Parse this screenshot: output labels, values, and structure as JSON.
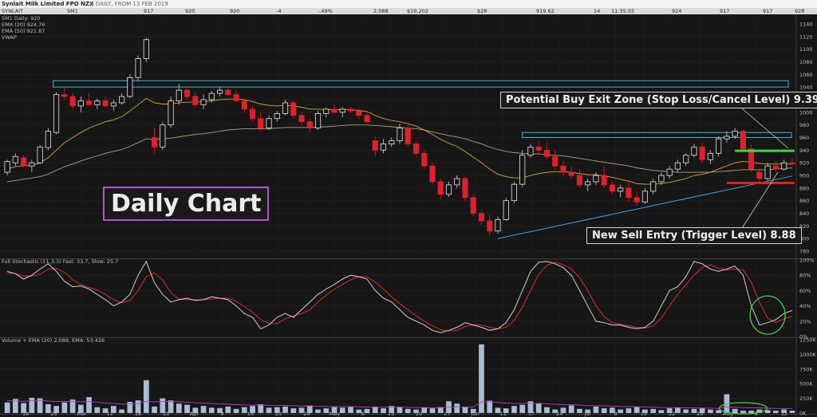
{
  "header": {
    "title": "Synlait Milk Limited FPO NZX",
    "subtitle": "DAILY, FROM 13 FEB 2019",
    "cells": [
      {
        "text": "SYNLAIT",
        "x": 2
      },
      {
        "text": "SM1",
        "x": 84
      },
      {
        "text": "917",
        "x": 180
      },
      {
        "text": "920",
        "x": 232
      },
      {
        "text": "920",
        "x": 288
      },
      {
        "text": "-4",
        "x": 346
      },
      {
        "text": "-.49%",
        "x": 398
      },
      {
        "text": "2,088",
        "x": 468
      },
      {
        "text": "$19,202",
        "x": 510
      },
      {
        "text": "$28",
        "x": 598
      },
      {
        "text": "919.62",
        "x": 672
      },
      {
        "text": "14",
        "x": 744
      },
      {
        "text": "11:35:55",
        "x": 766
      },
      {
        "text": "924",
        "x": 842
      },
      {
        "text": "917",
        "x": 902
      },
      {
        "text": "917",
        "x": 956
      },
      {
        "text": "928",
        "x": 996
      }
    ]
  },
  "legend": {
    "price": [
      "SM1 Daily: 920",
      "EMA (20) 924.76",
      "EMA (50) 921.87",
      "VWAP"
    ],
    "stoch": "Full Stochastic (11,3,3) Fast: 33.7, Slow: 25.7",
    "volume": "Volume + EMA (20) 2,088, EMA: 53,426"
  },
  "callouts": {
    "buy": "Potential Buy Exit Zone (Stop Loss/Cancel Level) 9.39",
    "sell": "New Sell Entry (Trigger Level) 8.88",
    "daily": "Daily Chart"
  },
  "colors": {
    "up": "#ffffff",
    "down": "#e0202a",
    "ema20": "#d8a637",
    "ema50": "#b2a070",
    "resistance": "#38b8e6",
    "trend": "#3f9fe6",
    "stochFast": "#d0d0d0",
    "stochSlow": "#e02a2a",
    "volEma": "#c03cc0",
    "volBar": "#a8bcd6",
    "buyZone": "#3fd24a",
    "sellLine": "#e02020",
    "highlight": "#3fd24a"
  },
  "chart_data": [
    {
      "type": "candlestick",
      "title": "",
      "ylim": [
        770,
        1150
      ],
      "yticks": [
        780,
        800,
        820,
        840,
        860,
        880,
        900,
        920,
        940,
        960,
        980,
        1000,
        1020,
        1040,
        1060,
        1080,
        1100,
        1120,
        1140
      ],
      "xticks": [
        "18",
        "25",
        "Mar",
        "11",
        "18",
        "25",
        "Apr",
        "8",
        "15",
        "23",
        "29",
        "May",
        "6",
        "13",
        "20",
        "27",
        "Jun",
        "11",
        "17",
        "24",
        "Jul",
        "8",
        "15",
        "22",
        "29",
        "Aug",
        "6",
        "12"
      ],
      "ohlc": [
        [
          905,
          925,
          900,
          922
        ],
        [
          920,
          935,
          915,
          930
        ],
        [
          928,
          932,
          912,
          915
        ],
        [
          915,
          925,
          905,
          920
        ],
        [
          920,
          948,
          918,
          945
        ],
        [
          944,
          975,
          940,
          970
        ],
        [
          968,
          1032,
          965,
          1028
        ],
        [
          1028,
          1040,
          1020,
          1025
        ],
        [
          1025,
          1030,
          1005,
          1010
        ],
        [
          1010,
          1025,
          1000,
          1018
        ],
        [
          1018,
          1030,
          1010,
          1012
        ],
        [
          1012,
          1022,
          1005,
          1018
        ],
        [
          1018,
          1025,
          1008,
          1010
        ],
        [
          1010,
          1020,
          1002,
          1015
        ],
        [
          1015,
          1030,
          1012,
          1025
        ],
        [
          1025,
          1060,
          1022,
          1055
        ],
        [
          1055,
          1090,
          1050,
          1085
        ],
        [
          1085,
          1118,
          1080,
          1115
        ],
        [
          960,
          975,
          935,
          945
        ],
        [
          945,
          985,
          940,
          980
        ],
        [
          980,
          1025,
          975,
          1018
        ],
        [
          1018,
          1045,
          1012,
          1035
        ],
        [
          1035,
          1040,
          1020,
          1025
        ],
        [
          1025,
          1032,
          1008,
          1012
        ],
        [
          1012,
          1028,
          1005,
          1020
        ],
        [
          1020,
          1034,
          1015,
          1030
        ],
        [
          1030,
          1040,
          1025,
          1035
        ],
        [
          1035,
          1042,
          1025,
          1028
        ],
        [
          1028,
          1035,
          1015,
          1018
        ],
        [
          1018,
          1022,
          1000,
          1005
        ],
        [
          1005,
          1010,
          985,
          990
        ],
        [
          990,
          1000,
          970,
          975
        ],
        [
          975,
          995,
          972,
          990
        ],
        [
          990,
          1002,
          985,
          998
        ],
        [
          998,
          1020,
          995,
          1015
        ],
        [
          1015,
          1018,
          990,
          995
        ],
        [
          995,
          1000,
          980,
          985
        ],
        [
          985,
          990,
          968,
          975
        ],
        [
          975,
          1002,
          972,
          998
        ],
        [
          998,
          1008,
          992,
          1005
        ],
        [
          1005,
          1012,
          998,
          1000
        ],
        [
          1000,
          1008,
          992,
          1005
        ],
        [
          1005,
          1008,
          998,
          1002
        ],
        [
          1002,
          1006,
          990,
          995
        ],
        [
          995,
          998,
          982,
          985
        ],
        [
          955,
          962,
          930,
          940
        ],
        [
          940,
          958,
          935,
          950
        ],
        [
          950,
          960,
          945,
          955
        ],
        [
          955,
          982,
          950,
          975
        ],
        [
          975,
          980,
          945,
          950
        ],
        [
          950,
          955,
          930,
          935
        ],
        [
          935,
          940,
          910,
          915
        ],
        [
          915,
          920,
          885,
          890
        ],
        [
          890,
          895,
          862,
          870
        ],
        [
          870,
          890,
          866,
          885
        ],
        [
          885,
          900,
          880,
          895
        ],
        [
          895,
          898,
          860,
          865
        ],
        [
          865,
          870,
          835,
          840
        ],
        [
          840,
          845,
          822,
          828
        ],
        [
          828,
          838,
          805,
          812
        ],
        [
          812,
          835,
          808,
          830
        ],
        [
          830,
          865,
          828,
          860
        ],
        [
          860,
          890,
          856,
          886
        ],
        [
          886,
          940,
          882,
          932
        ],
        [
          932,
          950,
          928,
          945
        ],
        [
          945,
          955,
          935,
          940
        ],
        [
          940,
          952,
          925,
          930
        ],
        [
          930,
          940,
          910,
          915
        ],
        [
          915,
          922,
          898,
          905
        ],
        [
          905,
          915,
          895,
          900
        ],
        [
          900,
          910,
          880,
          885
        ],
        [
          885,
          895,
          875,
          890
        ],
        [
          890,
          905,
          885,
          900
        ],
        [
          900,
          915,
          880,
          885
        ],
        [
          885,
          890,
          870,
          875
        ],
        [
          875,
          885,
          865,
          880
        ],
        [
          880,
          890,
          858,
          865
        ],
        [
          865,
          875,
          852,
          858
        ],
        [
          858,
          880,
          855,
          875
        ],
        [
          875,
          895,
          870,
          890
        ],
        [
          890,
          905,
          885,
          900
        ],
        [
          900,
          915,
          895,
          910
        ],
        [
          910,
          925,
          905,
          920
        ],
        [
          920,
          935,
          915,
          932
        ],
        [
          932,
          950,
          928,
          945
        ],
        [
          945,
          952,
          920,
          925
        ],
        [
          925,
          940,
          918,
          935
        ],
        [
          935,
          962,
          930,
          958
        ],
        [
          958,
          970,
          952,
          962
        ],
        [
          962,
          975,
          958,
          970
        ],
        [
          970,
          972,
          938,
          942
        ],
        [
          942,
          948,
          905,
          910
        ],
        [
          905,
          912,
          888,
          895
        ],
        [
          895,
          920,
          892,
          915
        ],
        [
          915,
          922,
          905,
          910
        ],
        [
          910,
          925,
          908,
          920
        ],
        [
          920,
          928,
          915,
          918
        ]
      ],
      "ema20": [
        910,
        914,
        915,
        916,
        920,
        928,
        940,
        952,
        960,
        968,
        975,
        980,
        985,
        988,
        993,
        1002,
        1012,
        1022,
        1015,
        1013,
        1013,
        1015,
        1016,
        1016,
        1017,
        1018,
        1020,
        1021,
        1021,
        1020,
        1017,
        1013,
        1011,
        1010,
        1011,
        1010,
        1008,
        1005,
        1005,
        1004,
        1004,
        1004,
        1004,
        1003,
        1001,
        995,
        990,
        987,
        985,
        982,
        978,
        972,
        965,
        957,
        951,
        946,
        938,
        929,
        920,
        910,
        902,
        898,
        896,
        896,
        900,
        903,
        905,
        906,
        906,
        905,
        903,
        901,
        901,
        899,
        897,
        894,
        891,
        887,
        886,
        886,
        887,
        889,
        892,
        895,
        900,
        902,
        905,
        910,
        915,
        920,
        922,
        921,
        919,
        918,
        918,
        918,
        918
      ],
      "ema50": [
        890,
        892,
        894,
        896,
        898,
        902,
        908,
        914,
        918,
        923,
        927,
        931,
        935,
        938,
        941,
        946,
        952,
        958,
        957,
        958,
        959,
        961,
        963,
        965,
        966,
        968,
        970,
        972,
        973,
        974,
        974,
        974,
        974,
        975,
        976,
        976,
        976,
        976,
        977,
        977,
        978,
        979,
        980,
        980,
        980,
        979,
        978,
        977,
        976,
        975,
        974,
        972,
        969,
        966,
        963,
        961,
        958,
        954,
        950,
        945,
        941,
        938,
        936,
        935,
        934,
        934,
        933,
        932,
        931,
        929,
        927,
        925,
        923,
        921,
        919,
        917,
        915,
        912,
        910,
        908,
        907,
        906,
        905,
        905,
        905,
        905,
        905,
        906,
        907,
        908,
        909,
        909,
        909,
        909,
        910,
        911,
        912
      ],
      "resistance_upper": [
        1040,
        1050
      ],
      "resistance_lower": [
        960,
        968
      ],
      "trendline": [
        [
          60,
          800
        ],
        [
          96,
          899
        ]
      ],
      "buy_zone": 939,
      "sell_entry": 888
    },
    {
      "type": "line",
      "title": "",
      "ylim": [
        0,
        100
      ],
      "yticks": [
        0,
        20,
        40,
        60,
        80,
        100
      ],
      "tick_suffix": "%",
      "series": [
        {
          "values": [
            85,
            82,
            75,
            80,
            88,
            95,
            85,
            72,
            65,
            66,
            62,
            55,
            48,
            40,
            45,
            55,
            80,
            98,
            70,
            55,
            45,
            48,
            50,
            47,
            48,
            52,
            50,
            48,
            40,
            30,
            25,
            10,
            15,
            25,
            30,
            25,
            35,
            45,
            55,
            62,
            68,
            75,
            80,
            78,
            75,
            60,
            50,
            45,
            35,
            25,
            20,
            15,
            8,
            5,
            8,
            12,
            18,
            15,
            12,
            8,
            10,
            18,
            35,
            60,
            85,
            97,
            98,
            95,
            90,
            80,
            60,
            40,
            20,
            18,
            15,
            15,
            12,
            10,
            12,
            20,
            40,
            60,
            65,
            78,
            98,
            95,
            88,
            85,
            88,
            92,
            80,
            40,
            15,
            18,
            22,
            30,
            34
          ]
        },
        {
          "values": [
            83,
            82,
            79,
            79,
            81,
            88,
            89,
            84,
            74,
            68,
            64,
            61,
            55,
            48,
            44,
            47,
            60,
            78,
            83,
            74,
            57,
            49,
            48,
            48,
            48,
            49,
            50,
            50,
            46,
            39,
            32,
            22,
            17,
            17,
            23,
            27,
            30,
            35,
            45,
            54,
            62,
            68,
            74,
            78,
            78,
            71,
            62,
            52,
            43,
            35,
            27,
            20,
            14,
            9,
            7,
            8,
            13,
            15,
            15,
            12,
            10,
            12,
            21,
            38,
            60,
            81,
            93,
            97,
            94,
            88,
            77,
            60,
            40,
            26,
            18,
            16,
            14,
            12,
            11,
            14,
            24,
            40,
            55,
            68,
            80,
            90,
            94,
            89,
            87,
            88,
            87,
            71,
            45,
            24,
            18,
            23,
            26
          ]
        }
      ]
    },
    {
      "type": "bar",
      "title": "",
      "ylim": [
        0,
        1250000
      ],
      "yticks": [
        "0K",
        "250K",
        "500K",
        "750K",
        "1000K",
        "1250K"
      ],
      "values": [
        180,
        240,
        170,
        260,
        250,
        150,
        120,
        180,
        230,
        140,
        270,
        100,
        80,
        120,
        60,
        190,
        215,
        560,
        110,
        250,
        215,
        160,
        140,
        90,
        120,
        90,
        85,
        110,
        70,
        100,
        120,
        150,
        90,
        100,
        110,
        80,
        90,
        130,
        60,
        80,
        100,
        90,
        110,
        60,
        70,
        110,
        80,
        120,
        100,
        70,
        60,
        90,
        80,
        100,
        200,
        160,
        100,
        70,
        1170,
        210,
        90,
        80,
        120,
        140,
        200,
        170,
        100,
        60,
        90,
        130,
        70,
        60,
        110,
        80,
        90,
        60,
        80,
        100,
        60,
        70,
        50,
        80,
        90,
        60,
        70,
        80,
        60,
        50,
        320,
        70,
        40,
        40,
        60,
        50,
        40,
        60,
        40
      ],
      "ema": [
        210,
        205,
        200,
        210,
        215,
        205,
        195,
        195,
        200,
        190,
        200,
        185,
        170,
        165,
        150,
        155,
        160,
        200,
        190,
        195,
        195,
        190,
        185,
        175,
        170,
        162,
        155,
        150,
        142,
        138,
        135,
        137,
        132,
        130,
        128,
        123,
        120,
        122,
        115,
        112,
        110,
        108,
        108,
        104,
        101,
        101,
        99,
        100,
        100,
        97,
        93,
        92,
        91,
        91,
        101,
        105,
        104,
        101,
        190,
        190,
        180,
        170,
        165,
        162,
        164,
        164,
        157,
        148,
        142,
        141,
        134,
        127,
        125,
        121,
        118,
        112,
        109,
        108,
        103,
        99,
        94,
        93,
        92,
        89,
        87,
        86,
        83,
        79,
        102,
        98,
        93,
        88,
        85,
        81,
        77,
        76,
        72
      ]
    }
  ]
}
